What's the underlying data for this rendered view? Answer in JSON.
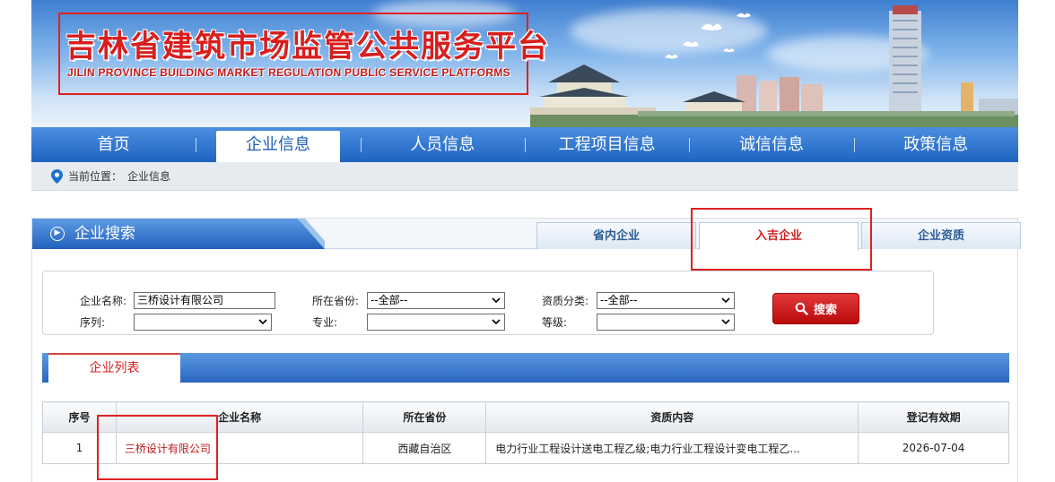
{
  "header": {
    "title_cn": "吉林省建筑市场监管公共服务平台",
    "title_en": "JILIN PROVINCE BUILDING MARKET REGULATION PUBLIC SERVICE PLATFORMS"
  },
  "nav": {
    "items": [
      {
        "label": "首页"
      },
      {
        "label": "企业信息"
      },
      {
        "label": "人员信息"
      },
      {
        "label": "工程项目信息"
      },
      {
        "label": "诚信信息"
      },
      {
        "label": "政策信息"
      }
    ],
    "active_index": 1
  },
  "breadcrumb": {
    "prefix": "当前位置：",
    "current": "企业信息"
  },
  "panel": {
    "title": "企业搜索",
    "tabs": [
      {
        "label": "省内企业"
      },
      {
        "label": "入吉企业"
      },
      {
        "label": "企业资质"
      }
    ],
    "active_tab": 1
  },
  "search": {
    "name_label": "企业名称:",
    "name_value": "三桥设计有限公司",
    "province_label": "所在省份:",
    "province_value": "--全部--",
    "category_label": "资质分类:",
    "category_value": "--全部--",
    "sequence_label": "序列:",
    "sequence_value": "",
    "major_label": "专业:",
    "major_value": "",
    "grade_label": "等级:",
    "grade_value": "",
    "button_label": "搜索"
  },
  "list": {
    "tab_label": "企业列表",
    "columns": [
      "序号",
      "企业名称",
      "所在省份",
      "资质内容",
      "登记有效期"
    ],
    "rows": [
      {
        "index": "1",
        "name": "三桥设计有限公司",
        "province": "西藏自治区",
        "qualification": "电力行业工程设计送电工程乙级;电力行业工程设计变电工程乙...",
        "valid_until": "2026-07-04"
      }
    ]
  },
  "colors": {
    "nav_blue": "#1f63c2",
    "accent_red": "#d02020",
    "highlight": "#e02020"
  }
}
